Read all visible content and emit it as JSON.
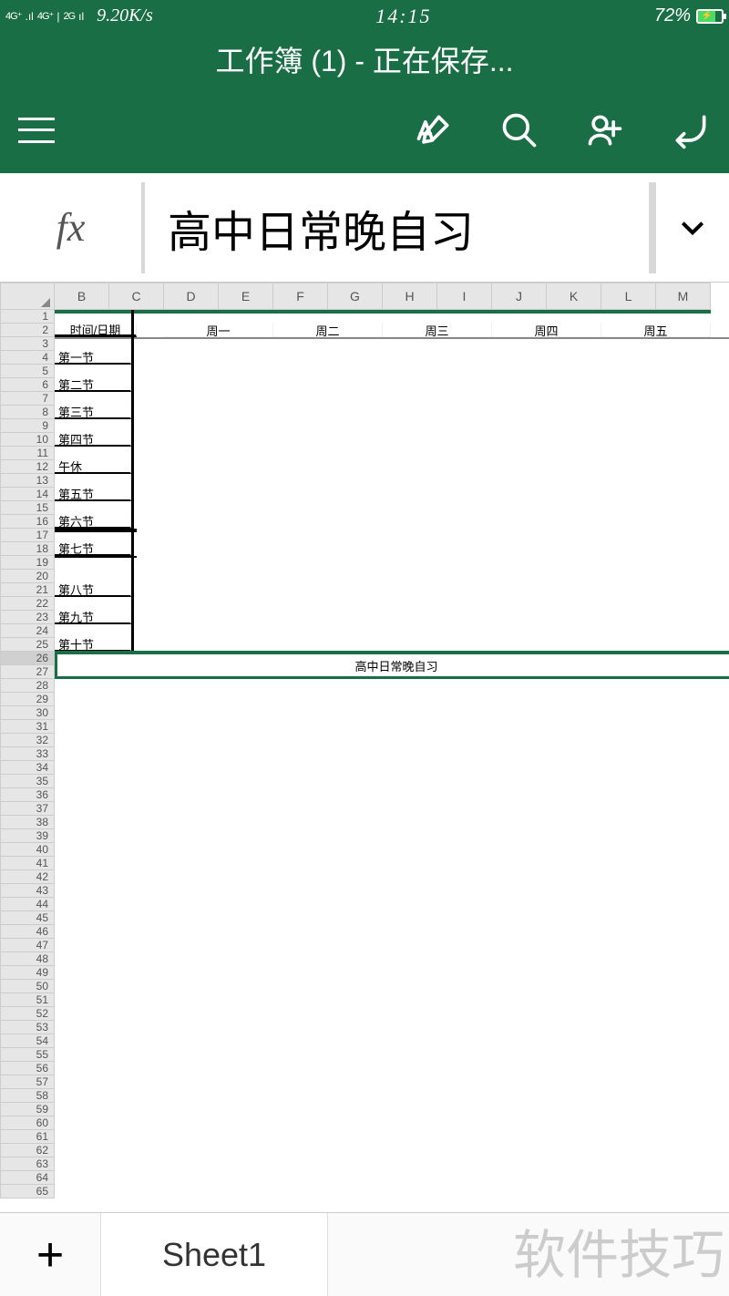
{
  "status": {
    "network1": "4G⁺",
    "network2": "4G⁺",
    "network3": "2G",
    "speed": "9.20K/s",
    "time": "14:15",
    "battery": "72%"
  },
  "title": "工作簿 (1) - 正在保存...",
  "formula": {
    "fx_label": "fx",
    "value": "高中日常晚自习"
  },
  "columns": [
    "B",
    "C",
    "D",
    "E",
    "F",
    "G",
    "H",
    "I",
    "J",
    "K",
    "L",
    "M"
  ],
  "row_count": 65,
  "selected_row": 26,
  "timetable": {
    "header_cell": "时间/日期",
    "days": [
      "周一",
      "周二",
      "周三",
      "周四",
      "周五"
    ],
    "periods": [
      "第一节",
      "第二节",
      "第三节",
      "第四节",
      "午休",
      "第五节",
      "第六节",
      "第七节",
      "第八节",
      "第九节",
      "第十节"
    ],
    "period_rows": [
      4,
      6,
      8,
      10,
      12,
      14,
      16,
      18,
      21,
      23,
      25
    ],
    "day_cols": [
      1,
      3,
      5,
      7,
      9,
      11
    ]
  },
  "selected_cell": {
    "content": "高中日常晚自习",
    "row": 26
  },
  "sheet": {
    "add": "+",
    "active_tab": "Sheet1"
  },
  "watermark": "软件技巧"
}
